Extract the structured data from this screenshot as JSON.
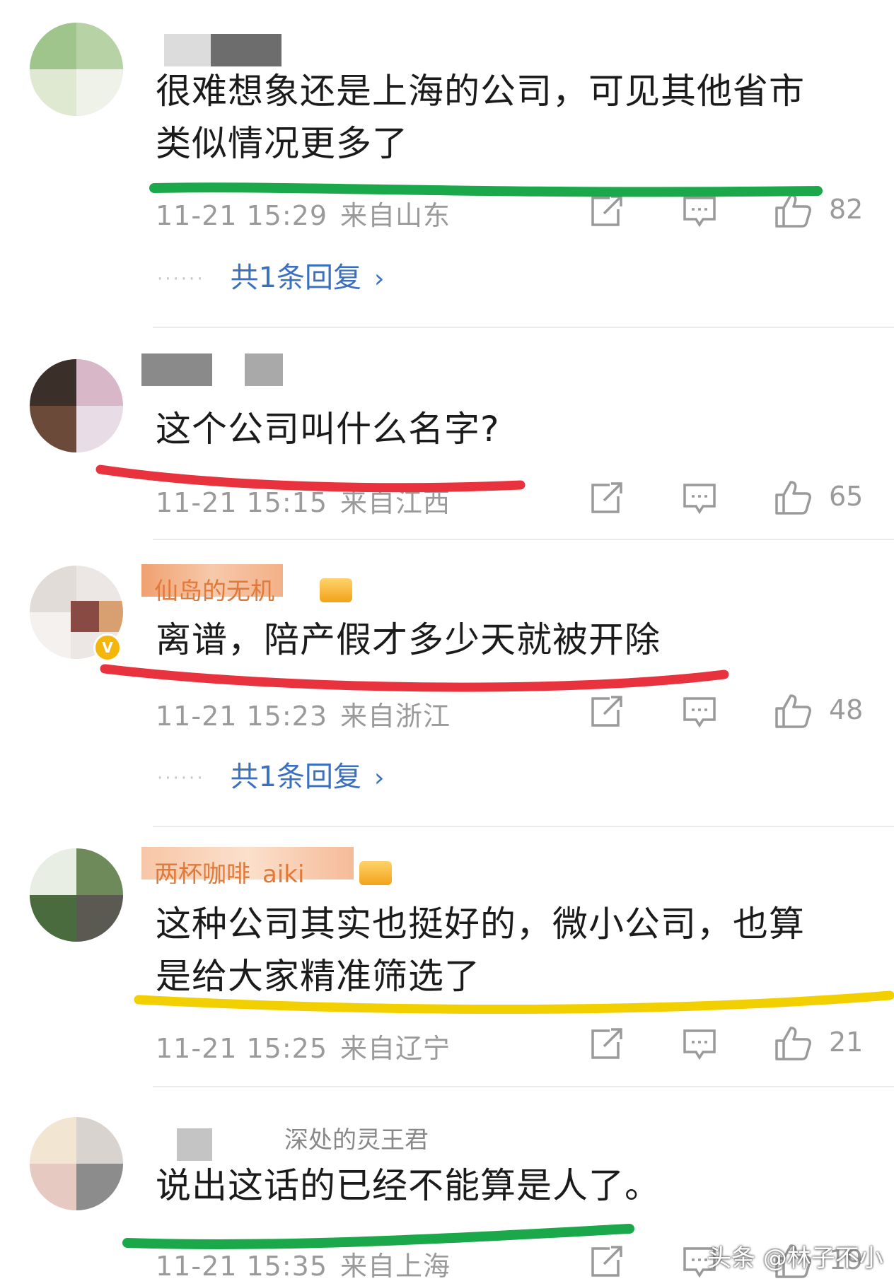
{
  "comments": [
    {
      "username": "",
      "text": "很难想象还是上海的公司，可见其他省市类似情况更多了",
      "time": "11-21 15:29",
      "location": "来自山东",
      "likes": "82",
      "replies": "共1条回复",
      "highlight_color": "#1aa84a"
    },
    {
      "username": "",
      "text": "这个公司叫什么名字?",
      "time": "11-21 15:15",
      "location": "来自江西",
      "likes": "65",
      "highlight_color": "#e8333e"
    },
    {
      "username": "仙岛的无机",
      "text": "离谱，陪产假才多少天就被开除",
      "time": "11-21 15:23",
      "location": "来自浙江",
      "likes": "48",
      "replies": "共1条回复",
      "highlight_color": "#e8333e"
    },
    {
      "username": "两杯咖啡_aiki",
      "text": "这种公司其实也挺好的，微小公司，也算是给大家精准筛选了",
      "time": "11-21 15:25",
      "location": "来自辽宁",
      "likes": "21",
      "highlight_color": "#f2d000"
    },
    {
      "username": "深处的灵王君",
      "text": "说出这话的已经不能算是人了。",
      "time": "11-21 15:35",
      "location": "来自上海",
      "likes": "19",
      "highlight_color": "#1aa84a"
    }
  ],
  "icons": {
    "share": "share-icon",
    "comment": "comment-icon",
    "like": "thumbs-up-icon",
    "chevron": "chevron-right-icon",
    "verified": "verified-v-badge"
  },
  "verified_label": "V",
  "watermark": "头条 @林子不小",
  "accent_link_color": "#3b6fbf"
}
